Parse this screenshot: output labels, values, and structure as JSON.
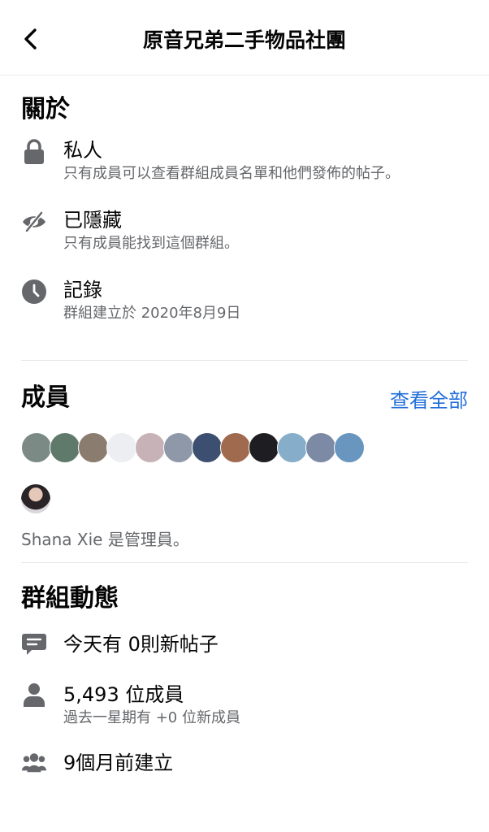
{
  "header": {
    "title": "原音兄弟二手物品社團",
    "back_icon": "chevron-left-icon"
  },
  "about": {
    "title": "關於",
    "items": [
      {
        "icon": "lock-icon",
        "label": "私人",
        "description": "只有成員可以查看群組成員名單和他們發佈的帖子。"
      },
      {
        "icon": "eye-slash-icon",
        "label": "已隱藏",
        "description": "只有成員能找到這個群組。"
      },
      {
        "icon": "clock-icon",
        "label": "記錄",
        "description": "群組建立於 2020年8月9日"
      }
    ]
  },
  "members": {
    "title": "成員",
    "see_all": "查看全部",
    "admin_text": "Shana Xie 是管理員。",
    "avatar_colors": [
      "#7c8a86",
      "#5f7a6a",
      "#8a7c6e",
      "#eceef2",
      "#c7b2b8",
      "#8e98a8",
      "#3d4f70",
      "#a06a4e",
      "#1e1e22",
      "#86aeca",
      "#7d8aa5",
      "#6896bf"
    ]
  },
  "activity": {
    "title": "群組動態",
    "items": [
      {
        "icon": "message-icon",
        "label": "今天有 0則新帖子",
        "description": ""
      },
      {
        "icon": "person-icon",
        "label": "5,493 位成員",
        "description": "過去一星期有 +0 位新成員"
      },
      {
        "icon": "group-icon",
        "label": "9個月前建立",
        "description": ""
      }
    ]
  },
  "colors": {
    "link": "#216fdb",
    "secondary_text": "#65676b",
    "icon": "#65676b",
    "divider": "#e4e6eb"
  }
}
